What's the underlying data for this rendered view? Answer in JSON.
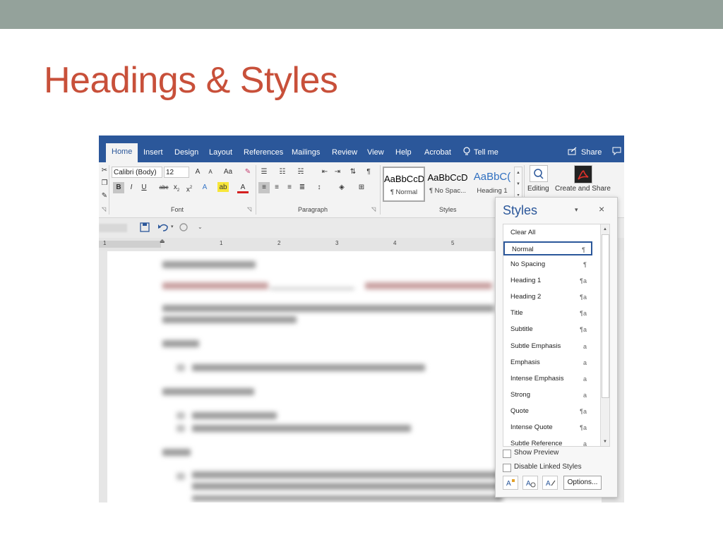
{
  "slide": {
    "title": "Headings & Styles"
  },
  "ribbon": {
    "tabs": [
      "Home",
      "Insert",
      "Design",
      "Layout",
      "References",
      "Mailings",
      "Review",
      "View",
      "Help",
      "Acrobat",
      "Tell me"
    ],
    "share": "Share",
    "font": {
      "name": "Calibri (Body)",
      "size": "12",
      "group_label": "Font"
    },
    "paragraph": {
      "group_label": "Paragraph"
    },
    "styles": {
      "group_label": "Styles",
      "cards": [
        {
          "sample": "AaBbCcD",
          "name": "¶ Normal"
        },
        {
          "sample": "AaBbCcD",
          "name": "¶ No Spac..."
        },
        {
          "sample": "AaBbC(",
          "name": "Heading 1"
        }
      ]
    },
    "editing": "Editing",
    "create_share": "Create and Share"
  },
  "ruler": {
    "numbers": [
      "1",
      "1",
      "2",
      "3",
      "4",
      "5"
    ]
  },
  "styles_pane": {
    "title": "Styles",
    "items": [
      {
        "label": "Clear All",
        "mark": ""
      },
      {
        "label": "Normal",
        "mark": "¶"
      },
      {
        "label": "No Spacing",
        "mark": "¶"
      },
      {
        "label": "Heading 1",
        "mark": "¶a"
      },
      {
        "label": "Heading 2",
        "mark": "¶a"
      },
      {
        "label": "Title",
        "mark": "¶a"
      },
      {
        "label": "Subtitle",
        "mark": "¶a"
      },
      {
        "label": "Subtle Emphasis",
        "mark": "a"
      },
      {
        "label": "Emphasis",
        "mark": "a"
      },
      {
        "label": "Intense Emphasis",
        "mark": "a"
      },
      {
        "label": "Strong",
        "mark": "a"
      },
      {
        "label": "Quote",
        "mark": "¶a"
      },
      {
        "label": "Intense Quote",
        "mark": "¶a"
      },
      {
        "label": "Subtle Reference",
        "mark": "a"
      }
    ],
    "show_preview": "Show Preview",
    "disable_linked": "Disable Linked Styles",
    "options": "Options..."
  },
  "colors": {
    "accent": "#2b579a",
    "title": "#c8503a",
    "band": "#94a29b"
  }
}
